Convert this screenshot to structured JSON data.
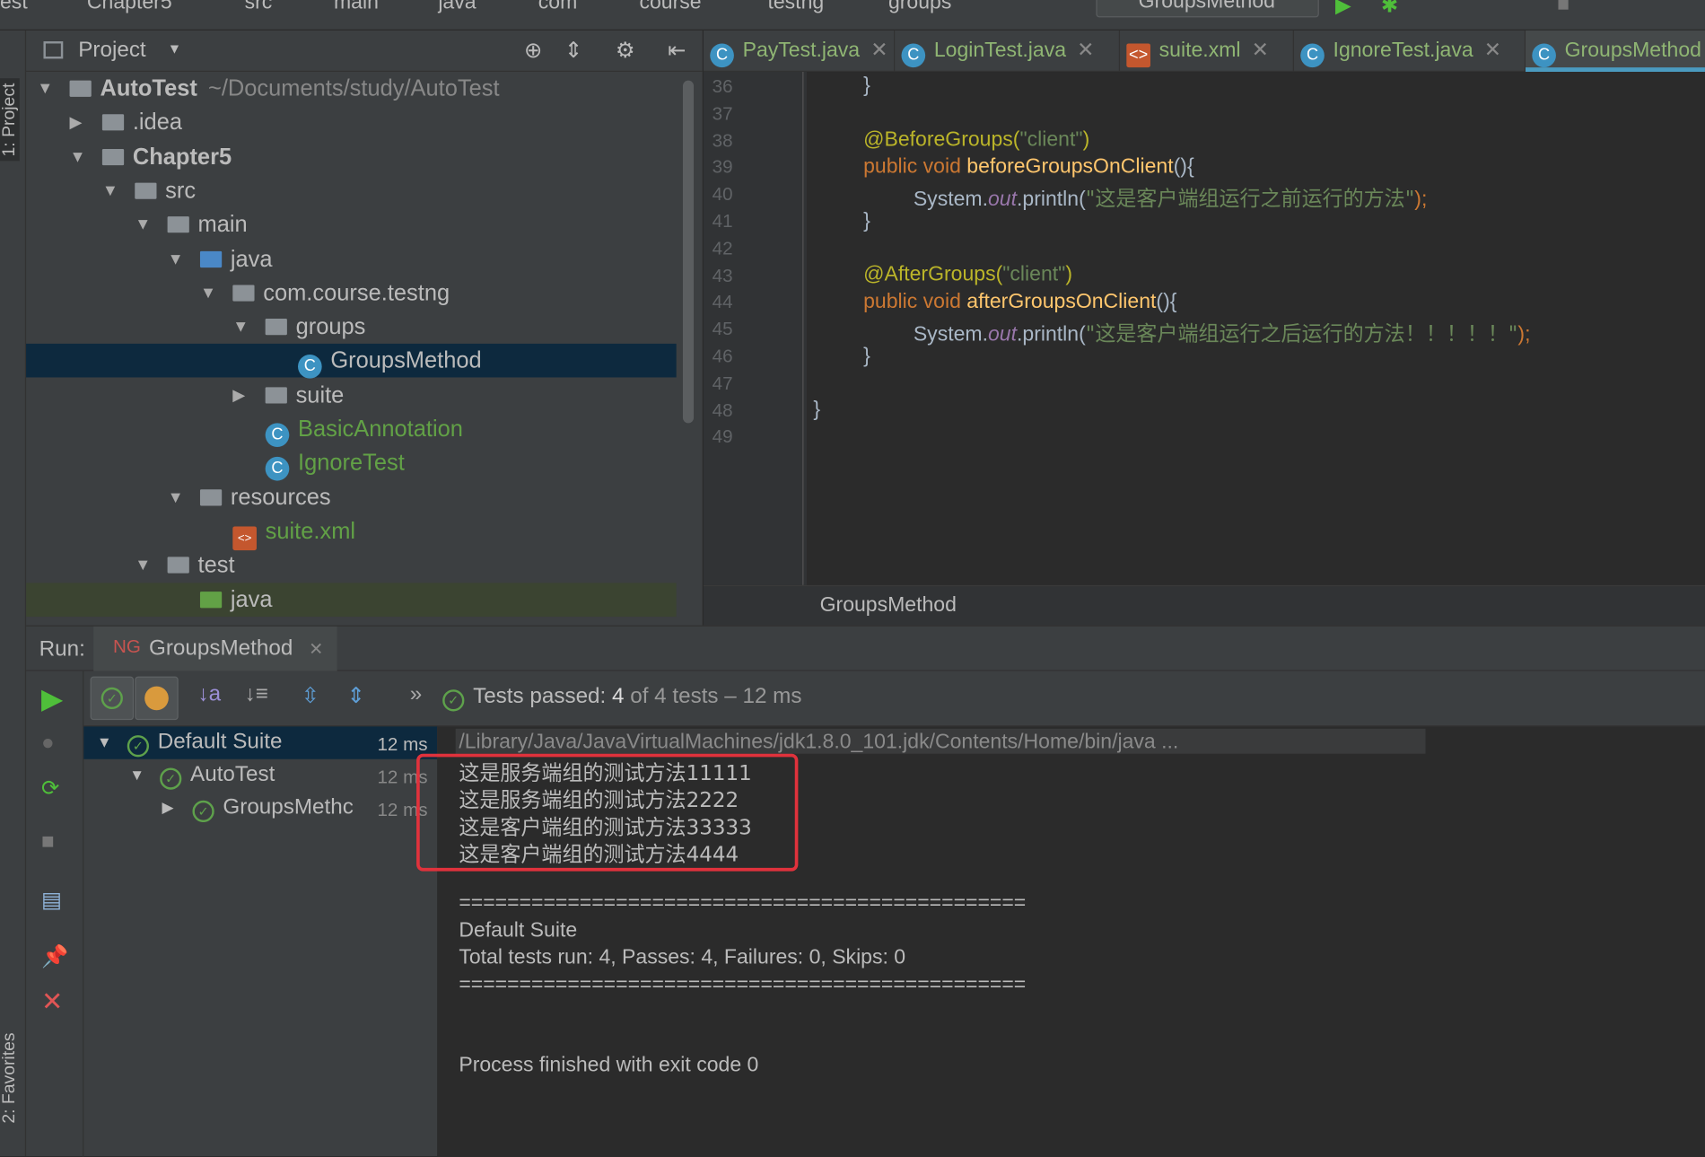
{
  "breadcrumb": [
    "est",
    "Chapter5",
    "src",
    "main",
    "java",
    "com",
    "course",
    "testng",
    "groups"
  ],
  "run_config": "GroupsMethod",
  "project_panel": {
    "title": "Project",
    "tree": [
      {
        "label": "AutoTest",
        "path": "~/Documents/study/AutoTest",
        "depth": 0,
        "expanded": true,
        "icon": "module-folder",
        "bold": true
      },
      {
        "label": ".idea",
        "depth": 1,
        "expanded": false,
        "icon": "folder"
      },
      {
        "label": "Chapter5",
        "depth": 1,
        "expanded": true,
        "icon": "module-folder",
        "bold": true
      },
      {
        "label": "src",
        "depth": 2,
        "expanded": true,
        "icon": "folder"
      },
      {
        "label": "main",
        "depth": 3,
        "expanded": true,
        "icon": "folder"
      },
      {
        "label": "java",
        "depth": 4,
        "expanded": true,
        "icon": "source-folder"
      },
      {
        "label": "com.course.testng",
        "depth": 5,
        "expanded": true,
        "icon": "package"
      },
      {
        "label": "groups",
        "depth": 6,
        "expanded": true,
        "icon": "package"
      },
      {
        "label": "GroupsMethod",
        "depth": 7,
        "icon": "class",
        "selected": true
      },
      {
        "label": "suite",
        "depth": 6,
        "expanded": false,
        "icon": "package"
      },
      {
        "label": "BasicAnnotation",
        "depth": 6,
        "icon": "class",
        "color": "#62a146"
      },
      {
        "label": "IgnoreTest",
        "depth": 6,
        "icon": "class",
        "color": "#62a146"
      },
      {
        "label": "resources",
        "depth": 4,
        "expanded": true,
        "icon": "resources-folder"
      },
      {
        "label": "suite.xml",
        "depth": 5,
        "icon": "xml",
        "color": "#62a146"
      },
      {
        "label": "test",
        "depth": 3,
        "expanded": true,
        "icon": "folder"
      },
      {
        "label": "java",
        "depth": 4,
        "icon": "test-folder",
        "highlight": true
      }
    ]
  },
  "editor": {
    "tabs": [
      "PayTest.java",
      "LoginTest.java",
      "suite.xml",
      "IgnoreTest.java",
      "GroupsMethod"
    ],
    "active_tab": 4,
    "line_numbers": [
      "36",
      "37",
      "38",
      "39",
      "40",
      "41",
      "42",
      "43",
      "44",
      "45",
      "46",
      "47",
      "48",
      "49"
    ],
    "code": {
      "l36": "}",
      "l38a": "@BeforeGroups(",
      "l38s": "\"client\"",
      "l38e": ")",
      "l39k": "public void ",
      "l39f": "beforeGroupsOnClient",
      "l39e": "(){",
      "l40a": "System.",
      "l40o": "out",
      "l40b": ".println(",
      "l40s": "\"这是客户端组运行之前运行的方法\"",
      "l40e": ");",
      "l41": "}",
      "l43a": "@AfterGroups(",
      "l43s": "\"client\"",
      "l43e": ")",
      "l44k": "public void ",
      "l44f": "afterGroupsOnClient",
      "l44e": "(){",
      "l45a": "System.",
      "l45o": "out",
      "l45b": ".println(",
      "l45s": "\"这是客户端组运行之后运行的方法！！！！！\"",
      "l45e": ");",
      "l46": "}",
      "l48": "}"
    },
    "breadcrumb": "GroupsMethod"
  },
  "run": {
    "label": "Run:",
    "tab": "GroupsMethod",
    "status": "Tests passed: ",
    "passed": "4",
    "of": " of 4 tests",
    "time": " – 12 ms",
    "tree": [
      {
        "label": "Default Suite",
        "time": "12 ms"
      },
      {
        "label": "AutoTest",
        "time": "12 ms"
      },
      {
        "label": "GroupsMethc",
        "time": "12 ms"
      }
    ],
    "console": [
      "/Library/Java/JavaVirtualMachines/jdk1.8.0_101.jdk/Contents/Home/bin/java ...",
      "这是服务端组的测试方法11111",
      "这是服务端组的测试方法2222",
      "这是客户端组的测试方法33333",
      "这是客户端组的测试方法4444",
      "",
      "===============================================",
      "Default Suite",
      "Total tests run: 4, Passes: 4, Failures: 0, Skips: 0",
      "===============================================",
      "",
      "",
      "Process finished with exit code 0"
    ]
  },
  "side_tabs": {
    "top": "1: Project",
    "bottom": "2: Favorites"
  },
  "colors": {
    "highlight_box": "#e0323c",
    "selection": "#0d293e",
    "pass": "#5ea14b"
  }
}
